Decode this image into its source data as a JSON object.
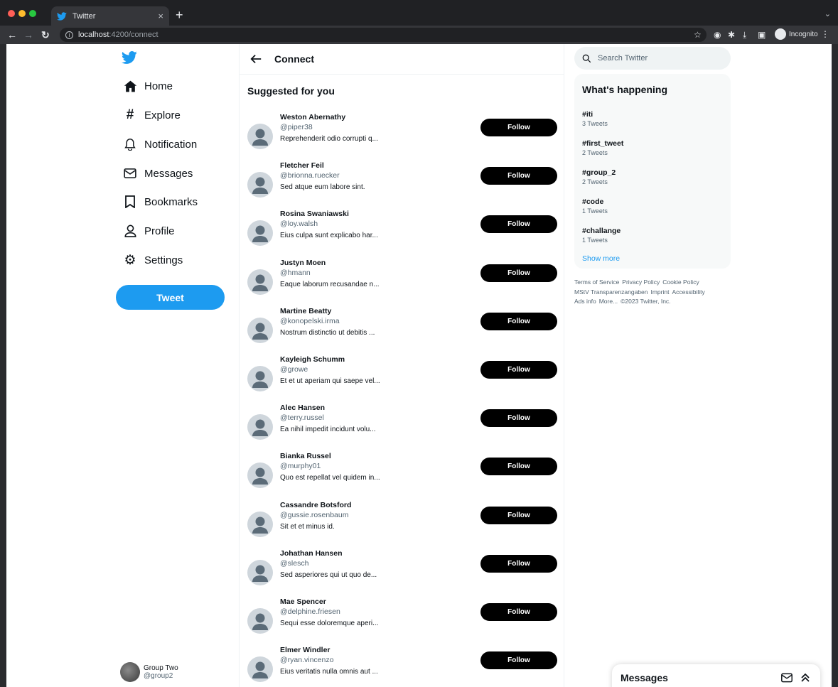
{
  "browser": {
    "tab_title": "Twitter",
    "new_tab": "+",
    "tab_close": "×",
    "url_host": "localhost",
    "url_path": ":4200/connect",
    "incognito_label": "Incognito"
  },
  "sidebar": {
    "items": [
      {
        "label": "Home",
        "icon": "home-icon"
      },
      {
        "label": "Explore",
        "icon": "hashtag-icon"
      },
      {
        "label": "Notification",
        "icon": "bell-icon"
      },
      {
        "label": "Messages",
        "icon": "envelope-icon"
      },
      {
        "label": "Bookmarks",
        "icon": "bookmark-icon"
      },
      {
        "label": "Profile",
        "icon": "person-icon"
      },
      {
        "label": "Settings",
        "icon": "gear-icon"
      }
    ],
    "tweet_button": "Tweet",
    "account": {
      "name": "Group Two",
      "handle": "@group2"
    }
  },
  "main": {
    "header_title": "Connect",
    "section_title": "Suggested for you",
    "follow_label": "Follow",
    "users": [
      {
        "name": "Weston Abernathy",
        "handle": "@piper38",
        "bio": "Reprehenderit odio corrupti q..."
      },
      {
        "name": "Fletcher Feil",
        "handle": "@brionna.ruecker",
        "bio": "Sed atque eum labore sint."
      },
      {
        "name": "Rosina Swaniawski",
        "handle": "@loy.walsh",
        "bio": "Eius culpa sunt explicabo har..."
      },
      {
        "name": "Justyn Moen",
        "handle": "@hmann",
        "bio": "Eaque laborum recusandae n..."
      },
      {
        "name": "Martine Beatty",
        "handle": "@konopelski.irma",
        "bio": "Nostrum distinctio ut debitis ..."
      },
      {
        "name": "Kayleigh Schumm",
        "handle": "@growe",
        "bio": "Et et ut aperiam qui saepe vel..."
      },
      {
        "name": "Alec Hansen",
        "handle": "@terry.russel",
        "bio": "Ea nihil impedit incidunt volu..."
      },
      {
        "name": "Bianka Russel",
        "handle": "@murphy01",
        "bio": "Quo est repellat vel quidem in..."
      },
      {
        "name": "Cassandre Botsford",
        "handle": "@gussie.rosenbaum",
        "bio": "Sit et et minus id."
      },
      {
        "name": "Johathan Hansen",
        "handle": "@slesch",
        "bio": "Sed asperiores qui ut quo de..."
      },
      {
        "name": "Mae Spencer",
        "handle": "@delphine.friesen",
        "bio": "Sequi esse doloremque aperi..."
      },
      {
        "name": "Elmer Windler",
        "handle": "@ryan.vincenzo",
        "bio": "Eius veritatis nulla omnis aut ..."
      }
    ]
  },
  "right": {
    "search_placeholder": "Search Twitter",
    "happening_title": "What's happening",
    "trends": [
      {
        "tag": "#iti",
        "count": "3 Tweets"
      },
      {
        "tag": "#first_tweet",
        "count": "2 Tweets"
      },
      {
        "tag": "#group_2",
        "count": "2 Tweets"
      },
      {
        "tag": "#code",
        "count": "1 Tweets"
      },
      {
        "tag": "#challange",
        "count": "1 Tweets"
      }
    ],
    "show_more": "Show more",
    "footer": {
      "links": [
        "Terms of Service",
        "Privacy Policy",
        "Cookie Policy",
        "MStV Transparenzangaben",
        "Imprint",
        "Accessibility",
        "Ads info",
        "More..."
      ],
      "copyright": "©2023 Twitter, Inc."
    }
  },
  "messages_drawer": {
    "title": "Messages"
  },
  "colors": {
    "accent": "#1d9bf0",
    "follow_bg": "#000000",
    "text": "#0f1419",
    "muted": "#536471"
  }
}
